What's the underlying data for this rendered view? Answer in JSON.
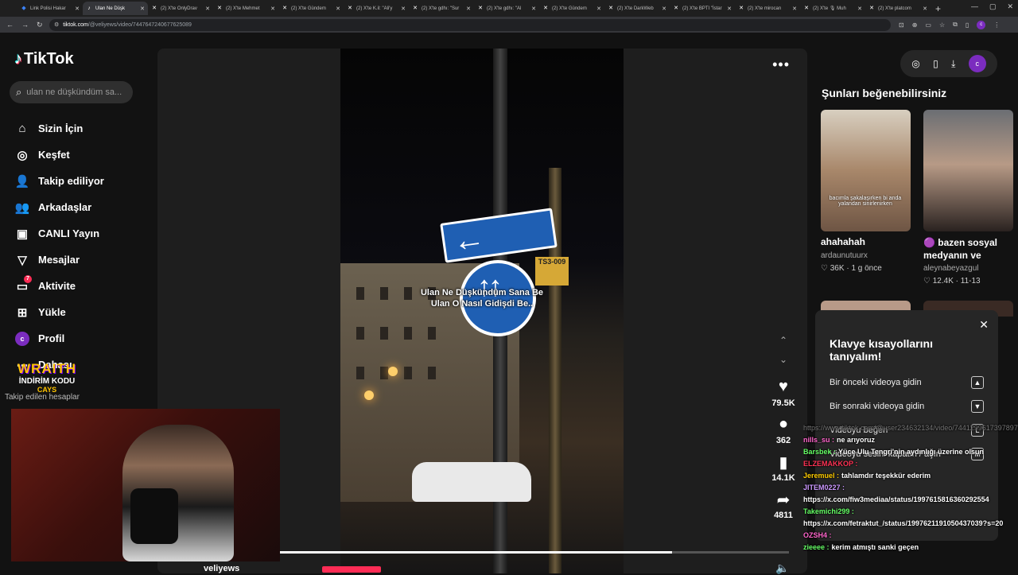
{
  "browser": {
    "tabs": [
      {
        "title": "Link Polisi Hakar",
        "fav": "◆",
        "fav_color": "#3b82f6"
      },
      {
        "title": "Ulan Ne Düşk",
        "fav": "♪",
        "fav_color": "#ffffff",
        "active": true
      },
      {
        "title": "(2) X'te OnlyDrav",
        "fav": "✕",
        "fav_color": "#ffffff"
      },
      {
        "title": "(2) X'te Mehmet",
        "fav": "✕",
        "fav_color": "#ffffff"
      },
      {
        "title": "(2) X'te Gündem",
        "fav": "✕",
        "fav_color": "#ffffff"
      },
      {
        "title": "(2) X'te K.il: \"Ali'y",
        "fav": "✕",
        "fav_color": "#ffffff"
      },
      {
        "title": "(2) X'te gdhı: \"Sur",
        "fav": "✕",
        "fav_color": "#ffffff"
      },
      {
        "title": "(2) X'te gdhı: \"Al",
        "fav": "✕",
        "fav_color": "#ffffff"
      },
      {
        "title": "(2) X'te Gündem",
        "fav": "✕",
        "fav_color": "#ffffff"
      },
      {
        "title": "(2) X'te DarkWeb",
        "fav": "✕",
        "fav_color": "#ffffff"
      },
      {
        "title": "(2) X'te BPTI \"İstar",
        "fav": "✕",
        "fav_color": "#ffffff"
      },
      {
        "title": "(2) X'te mirocan",
        "fav": "✕",
        "fav_color": "#ffffff"
      },
      {
        "title": "(2) X'te 🎙 Muh",
        "fav": "✕",
        "fav_color": "#ffffff"
      },
      {
        "title": "(2) X'te platcom",
        "fav": "✕",
        "fav_color": "#ffffff"
      }
    ],
    "url_host": "tiktok.com",
    "url_path": "/@veliyews/video/7447647240677625089"
  },
  "sidebar": {
    "logo": "TikTok",
    "search_placeholder": "ulan ne düşkündüm sa...",
    "items": [
      {
        "label": "Sizin İçin",
        "icon": "home-icon",
        "glyph": "⌂"
      },
      {
        "label": "Keşfet",
        "icon": "compass-icon",
        "glyph": "◎"
      },
      {
        "label": "Takip ediliyor",
        "icon": "following-icon",
        "glyph": "👤"
      },
      {
        "label": "Arkadaşlar",
        "icon": "friends-icon",
        "glyph": "👥"
      },
      {
        "label": "CANLI Yayın",
        "icon": "live-icon",
        "glyph": "▣"
      },
      {
        "label": "Mesajlar",
        "icon": "messages-icon",
        "glyph": "▽"
      },
      {
        "label": "Aktivite",
        "icon": "activity-icon",
        "glyph": "▭",
        "badge": "7"
      },
      {
        "label": "Yükle",
        "icon": "upload-icon",
        "glyph": "⊞"
      },
      {
        "label": "Profil",
        "icon": "profile-icon",
        "glyph": "c"
      },
      {
        "label": "Dahası",
        "icon": "more-icon",
        "glyph": "⋯"
      }
    ],
    "following_header": "Takip edilen hesaplar"
  },
  "video": {
    "caption_line1": "Ulan Ne Düşkündüm Sana Be",
    "caption_line2": "Ulan O Nasıl Gidişdi Be..",
    "sign_text": "TS3-009",
    "progress": 0.77,
    "author": "veliyews"
  },
  "actions": {
    "likes": "79.5K",
    "comments": "362",
    "saves": "14.1K",
    "shares": "4811"
  },
  "right": {
    "title": "Şunları beğenebilirsiniz",
    "avatar_letter": "c",
    "recommendations": [
      {
        "desc": "ahahahah",
        "author": "ardaunutuurx",
        "likes": "36K",
        "age": "1 g önce",
        "thumb_caption": "bacımla şakalaşırken bi anda yalandan sinirlenirken"
      },
      {
        "desc": "🟣 bazen sosyal medyanın ve hayatın...",
        "author": "aleynabeyazgul",
        "likes": "12.4K",
        "age": "11-13",
        "thumb_caption": ""
      }
    ]
  },
  "keyboard": {
    "title": "Klavye kısayollarını tanıyalım!",
    "rows": [
      {
        "label": "Bir önceki videoya gidin",
        "key": "▲"
      },
      {
        "label": "Bir sonraki videoya gidin",
        "key": "▼"
      },
      {
        "label": "Videoyu beğen",
        "key": "L"
      },
      {
        "label": "Videoyu sesini kapatın / açın",
        "key": "M"
      }
    ]
  },
  "overlay": {
    "promo_line1": "WRAITH",
    "promo_line2": "İNDİRİM KODU",
    "promo_line3": "CAYS",
    "chat": [
      {
        "user": "",
        "msg": "https://www.tiktok.com/@user234632134/video/7441299617397897",
        "user_color": "#888",
        "ghost": true
      },
      {
        "user": "nills_su :",
        "msg": "ne arıyoruz",
        "user_color": "#ff66cc"
      },
      {
        "user": "Barsbek :",
        "msg": "Yüce Ulu Tengri'nin aydınlığı üzerine olsun",
        "user_color": "#66ff66"
      },
      {
        "user": "ELZEMAKKOP :",
        "msg": "",
        "user_color": "#ff3355"
      },
      {
        "user": "Jeremuel :",
        "msg": "tahlamdır teşekkür ederim",
        "user_color": "#ffcc00"
      },
      {
        "user": "JITEM0227 :",
        "msg": "",
        "user_color": "#cc99ff"
      },
      {
        "user": "",
        "msg": "https://x.com/fiw3mediaa/status/1997615816360292554",
        "user_color": "#fff"
      },
      {
        "user": "Takemichi299 :",
        "msg": "",
        "user_color": "#66ff66"
      },
      {
        "user": "",
        "msg": "https://x.com/fetraktut_/status/1997621191050437039?s=20",
        "user_color": "#fff"
      },
      {
        "user": "OZSH4 :",
        "msg": "",
        "user_color": "#ff66cc"
      },
      {
        "user": "zieeee :",
        "msg": "kerim atmıştı sanki geçen",
        "user_color": "#66ff66"
      }
    ]
  }
}
